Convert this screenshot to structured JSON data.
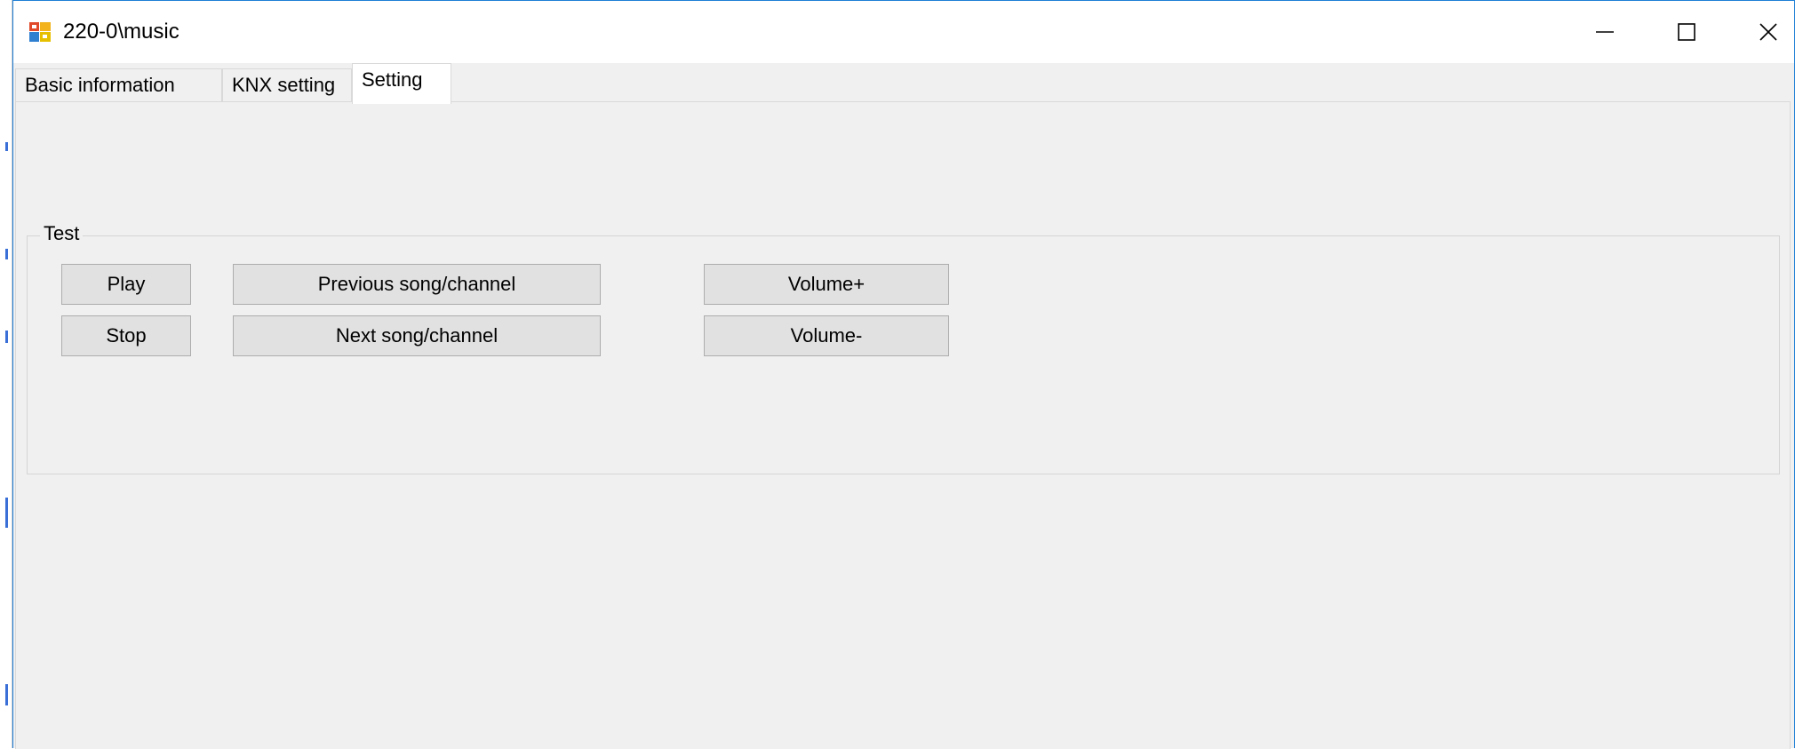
{
  "window": {
    "title": "220-0\\music",
    "controls": {
      "minimize_icon": "minimize-icon",
      "maximize_icon": "maximize-icon",
      "close_icon": "close-icon"
    },
    "accent_color": "#1e7fd6"
  },
  "tabs": [
    {
      "label": "Basic information",
      "active": false
    },
    {
      "label": "KNX setting",
      "active": false
    },
    {
      "label": "Setting",
      "active": true
    }
  ],
  "test_group": {
    "legend": "Test",
    "buttons": {
      "play": "Play",
      "stop": "Stop",
      "previous": "Previous song/channel",
      "next": "Next song/channel",
      "volume_up": "Volume+",
      "volume_down": "Volume-"
    }
  }
}
